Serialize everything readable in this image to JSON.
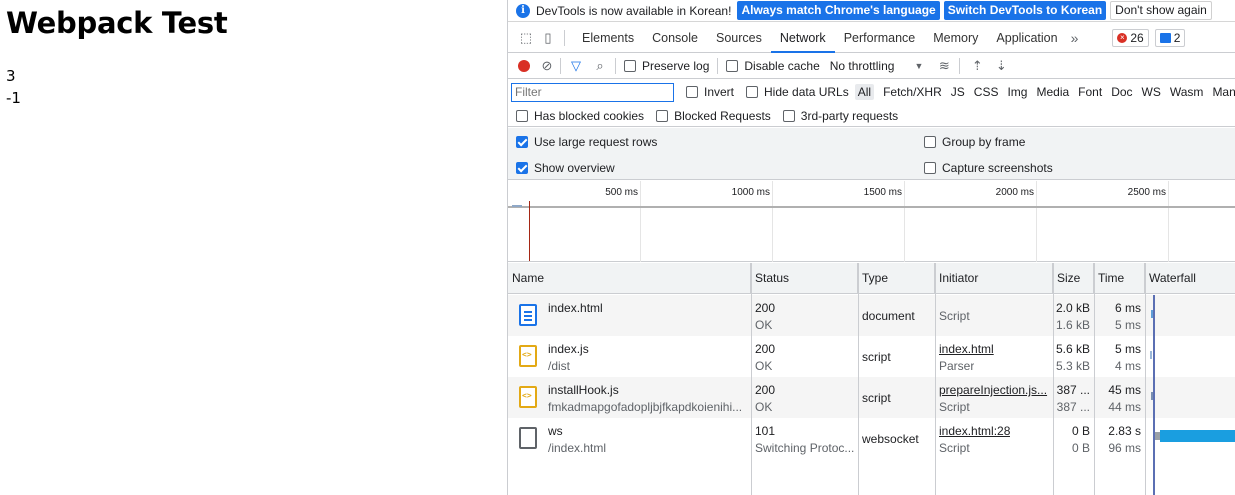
{
  "page": {
    "title": "Webpack Test",
    "outputs": [
      "3",
      "-1"
    ]
  },
  "devtools": {
    "infobar": {
      "message": "DevTools is now available in Korean!",
      "btn_match": "Always match Chrome's language",
      "btn_switch": "Switch DevTools to Korean",
      "btn_dismiss": "Don't show again"
    },
    "tabs": [
      "Elements",
      "Console",
      "Sources",
      "Network",
      "Performance",
      "Memory",
      "Application"
    ],
    "active_tab": "Network",
    "error_count": "26",
    "message_count": "2",
    "toolbar": {
      "preserve_log": "Preserve log",
      "disable_cache": "Disable cache",
      "throttling": "No throttling"
    },
    "filter": {
      "placeholder": "Filter",
      "invert": "Invert",
      "hide_data_urls": "Hide data URLs",
      "types": [
        "All",
        "Fetch/XHR",
        "JS",
        "CSS",
        "Img",
        "Media",
        "Font",
        "Doc",
        "WS",
        "Wasm",
        "Manit"
      ]
    },
    "row3": {
      "blocked_cookies": "Has blocked cookies",
      "blocked_requests": "Blocked Requests",
      "third_party": "3rd-party requests"
    },
    "settings": {
      "large_rows": "Use large request rows",
      "show_overview": "Show overview",
      "group_by_frame": "Group by frame",
      "capture_screenshots": "Capture screenshots"
    },
    "overview_ticks": [
      "500 ms",
      "1000 ms",
      "1500 ms",
      "2000 ms",
      "2500 ms"
    ],
    "columns": [
      "Name",
      "Status",
      "Type",
      "Initiator",
      "Size",
      "Time",
      "Waterfall"
    ],
    "rows": [
      {
        "name": "index.html",
        "path": "",
        "status": "200",
        "status_text": "OK",
        "type": "document",
        "initiator": "Script",
        "initiator_sub": "",
        "size": "2.0 kB",
        "size_sub": "1.6 kB",
        "time": "6 ms",
        "time_sub": "5 ms",
        "icon": "document-icon"
      },
      {
        "name": "index.js",
        "path": "/dist",
        "status": "200",
        "status_text": "OK",
        "type": "script",
        "initiator": "index.html",
        "initiator_sub": "Parser",
        "size": "5.6 kB",
        "size_sub": "5.3 kB",
        "time": "5 ms",
        "time_sub": "4 ms",
        "icon": "script-icon"
      },
      {
        "name": "installHook.js",
        "path": "fmkadmapgofadopljbjfkapdkoienihi...",
        "status": "200",
        "status_text": "OK",
        "type": "script",
        "initiator": "prepareInjection.js...",
        "initiator_sub": "Script",
        "size": "387 ...",
        "size_sub": "387 ...",
        "time": "45 ms",
        "time_sub": "44 ms",
        "icon": "script-icon"
      },
      {
        "name": "ws",
        "path": "/index.html",
        "status": "101",
        "status_text": "Switching Protoc...",
        "type": "websocket",
        "initiator": "index.html:28",
        "initiator_sub": "Script",
        "size": "0 B",
        "size_sub": "0 B",
        "time": "2.83 s",
        "time_sub": "96 ms",
        "icon": "websocket-icon"
      }
    ]
  }
}
